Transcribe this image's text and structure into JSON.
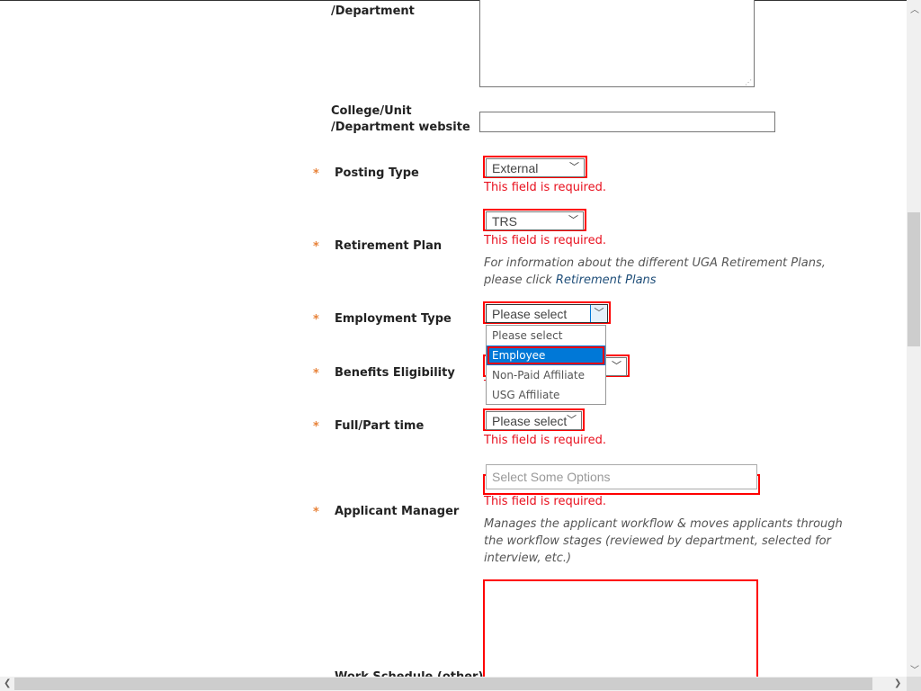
{
  "form": {
    "department_label": "/Department",
    "website_label_1": "College/Unit",
    "website_label_2": "/Department website",
    "website_value": "",
    "required_marker": "*",
    "required_error": "This field is required.",
    "posting_type": {
      "label": "Posting Type",
      "value": "External"
    },
    "retirement_plan": {
      "label": "Retirement Plan",
      "value": "TRS",
      "help_prefix": "For information about the different UGA Retirement Plans, please click ",
      "help_link": "Retirement Plans"
    },
    "employment_type": {
      "label": "Employment Type",
      "value": "Please select",
      "options": [
        "Please select",
        "Employee",
        "Non-Paid Affiliate",
        "USG Affiliate"
      ],
      "highlighted": "Employee"
    },
    "benefits_eligibility": {
      "label": "Benefits Eligibility"
    },
    "full_part_time": {
      "label": "Full/Part time",
      "value": "Please select"
    },
    "applicant_manager": {
      "label": "Applicant Manager",
      "placeholder": "Select Some Options",
      "help": "Manages the applicant workflow & moves applicants through the workflow stages (reviewed by department, selected for interview, etc.)"
    },
    "work_schedule": {
      "label": "Work Schedule (other)"
    }
  },
  "colors": {
    "error": "#e8101e",
    "required_star": "#e8833a",
    "highlight": "#0078d7"
  }
}
